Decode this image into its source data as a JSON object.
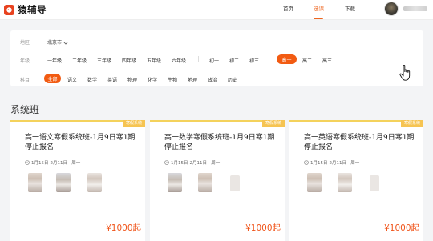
{
  "header": {
    "logo_text": "猿辅导",
    "nav": [
      "首页",
      "选课",
      "下载"
    ],
    "active_nav": "选课"
  },
  "filter": {
    "region_label": "地区",
    "region_value": "北京市",
    "grade_label": "年级",
    "grades_primary": [
      "一年级",
      "二年级",
      "三年级",
      "四年级",
      "五年级",
      "六年级"
    ],
    "grades_middle": [
      "初一",
      "初二",
      "初三"
    ],
    "grades_high": [
      "高一",
      "高二",
      "高三"
    ],
    "selected_grade": "高一",
    "subject_label": "科目",
    "subjects": [
      "全部",
      "语文",
      "数学",
      "英语",
      "物理",
      "化学",
      "生物",
      "地理",
      "政治",
      "历史"
    ],
    "selected_subject": "全部"
  },
  "section_title": "系统班",
  "cards": [
    {
      "badge": "寒假系统",
      "title": "高一语文寒假系统班-1月9日寒1期停止报名",
      "date": "1月15日-2月11日 · 周一",
      "price": "¥1000起"
    },
    {
      "badge": "寒假系统",
      "title": "高一数学寒假系统班-1月9日寒1期停止报名",
      "date": "1月15日-2月11日 · 周一",
      "price": "¥1000起"
    },
    {
      "badge": "寒假系统",
      "title": "高一英语寒假系统班-1月9日寒1期停止报名",
      "date": "1月15日-2月11日 · 周一",
      "price": "¥1000起"
    }
  ],
  "colors": {
    "accent": "#f25b12",
    "badge": "#f6c452",
    "price": "#f0551b"
  }
}
